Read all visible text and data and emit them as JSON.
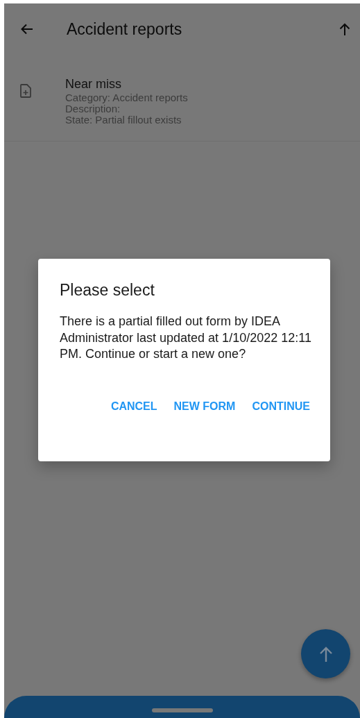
{
  "app_bar": {
    "title": "Accident reports"
  },
  "list": [
    {
      "title": "Near miss",
      "lines": [
        "Category: Accident reports",
        "Description:",
        "State: Partial fillout exists"
      ]
    }
  ],
  "dialog": {
    "title": "Please select",
    "message": "There is a partial filled out form by IDEA Administrator last updated at 1/10/2022 12:11 PM. Continue or start a new one?",
    "buttons": [
      "CANCEL",
      "NEW FORM",
      "CONTINUE"
    ]
  }
}
